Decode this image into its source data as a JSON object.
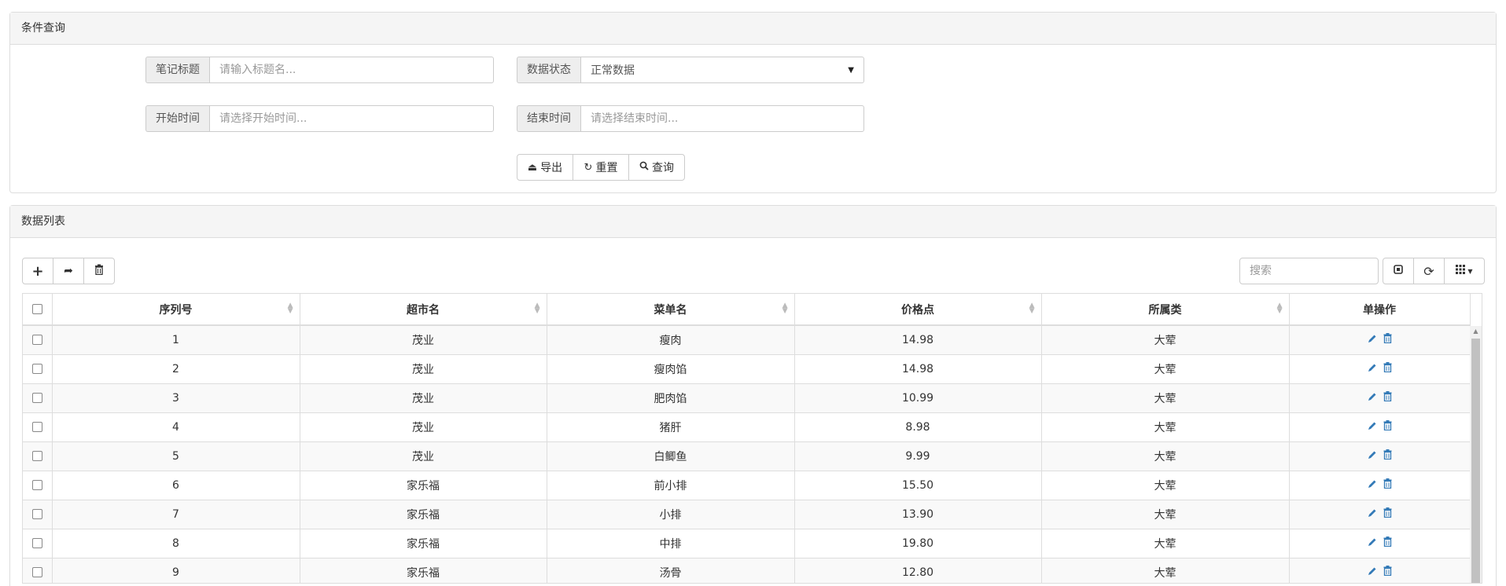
{
  "query_panel": {
    "title": "条件查询",
    "note_title": {
      "label": "笔记标题",
      "placeholder": "请输入标题名..."
    },
    "data_status": {
      "label": "数据状态",
      "value": "正常数据"
    },
    "start_time": {
      "label": "开始时间",
      "placeholder": "请选择开始时间..."
    },
    "end_time": {
      "label": "结束时间",
      "placeholder": "请选择结束时间..."
    },
    "buttons": {
      "export": "导出",
      "reset": "重置",
      "query": "查询"
    }
  },
  "list_panel": {
    "title": "数据列表",
    "search_placeholder": "搜索",
    "columns": [
      "序列号",
      "超市名",
      "菜单名",
      "价格点",
      "所属类",
      "单操作"
    ],
    "rows": [
      {
        "id": "1",
        "market": "茂业",
        "dish": "瘦肉",
        "price": "14.98",
        "category": "大荤"
      },
      {
        "id": "2",
        "market": "茂业",
        "dish": "瘦肉馅",
        "price": "14.98",
        "category": "大荤"
      },
      {
        "id": "3",
        "market": "茂业",
        "dish": "肥肉馅",
        "price": "10.99",
        "category": "大荤"
      },
      {
        "id": "4",
        "market": "茂业",
        "dish": "猪肝",
        "price": "8.98",
        "category": "大荤"
      },
      {
        "id": "5",
        "market": "茂业",
        "dish": "白鲫鱼",
        "price": "9.99",
        "category": "大荤"
      },
      {
        "id": "6",
        "market": "家乐福",
        "dish": "前小排",
        "price": "15.50",
        "category": "大荤"
      },
      {
        "id": "7",
        "market": "家乐福",
        "dish": "小排",
        "price": "13.90",
        "category": "大荤"
      },
      {
        "id": "8",
        "market": "家乐福",
        "dish": "中排",
        "price": "19.80",
        "category": "大荤"
      },
      {
        "id": "9",
        "market": "家乐福",
        "dish": "汤骨",
        "price": "12.80",
        "category": "大荤"
      }
    ]
  },
  "colors": {
    "accent": "#337ab7",
    "border": "#ddd",
    "heading_bg": "#f5f5f5"
  }
}
